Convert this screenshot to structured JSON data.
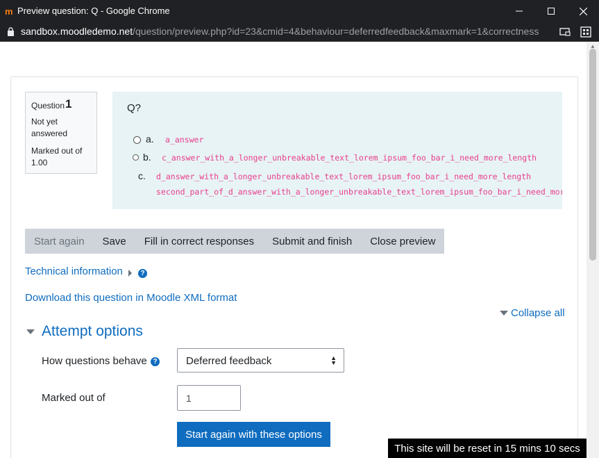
{
  "window": {
    "app_icon": "moodle-icon",
    "title": "Preview question: Q - Google Chrome"
  },
  "address_bar": {
    "host": "sandbox.moodledemo.net",
    "path": "/question/preview.php?id=23&cmid=4&behaviour=deferredfeedback&maxmark=1&correctness"
  },
  "question_info": {
    "label": "Question",
    "number": "1",
    "state": "Not yet answered",
    "grade": "Marked out of 1.00"
  },
  "question": {
    "text": "Q?",
    "answers": [
      {
        "letter": "a.",
        "text": "a_answer"
      },
      {
        "letter": "b.",
        "text": "c_answer_with_a_longer_unbreakable_text_lorem_ipsum_foo_bar_i_need_more_length"
      },
      {
        "letter": "c.",
        "text": "d_answer_with_a_longer_unbreakable_text_lorem_ipsum_foo_bar_i_need_more_length",
        "text2": "second_part_of_d_answer_with_a_longer_unbreakable_text_lorem_ipsum_foo_bar_i_need_mor"
      }
    ]
  },
  "controls": {
    "start_again": "Start again",
    "save": "Save",
    "fill_correct": "Fill in correct responses",
    "submit_finish": "Submit and finish",
    "close_preview": "Close preview"
  },
  "links": {
    "technical_info": "Technical information",
    "download_xml": "Download this question in Moodle XML format",
    "collapse_all": "Collapse all"
  },
  "attempt_options": {
    "title": "Attempt options",
    "behave_label": "How questions behave",
    "behave_value": "Deferred feedback",
    "marked_label": "Marked out of",
    "marked_value": "1",
    "submit_label": "Start again with these options"
  },
  "notice": "This site will be reset in 15 mins 10 secs",
  "colors": {
    "link": "#0f6cbf",
    "answer_text": "#e83e8c",
    "formulation_bg": "#e7f3f5",
    "chrome_bg": "#202124"
  }
}
